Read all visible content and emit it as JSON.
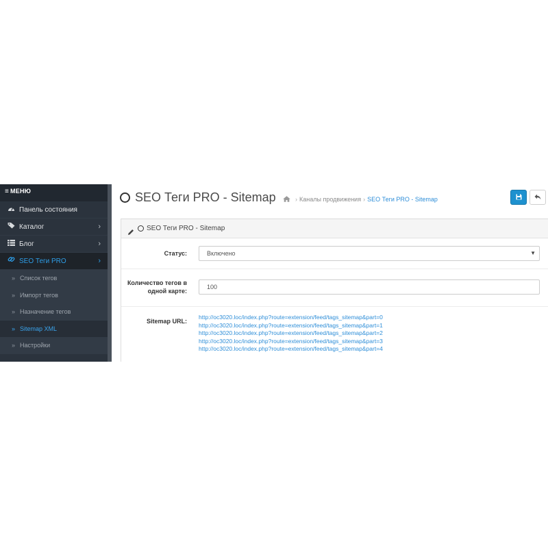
{
  "sidebar": {
    "menu_label": "МЕНЮ",
    "items": [
      {
        "label": "Панель состояния",
        "icon": "dashboard-icon",
        "has_chevron": false
      },
      {
        "label": "Каталог",
        "icon": "tags-icon",
        "has_chevron": true
      },
      {
        "label": "Блог",
        "icon": "list-icon",
        "has_chevron": true
      },
      {
        "label": "SEO Теги PRO",
        "icon": "link-icon",
        "has_chevron": true,
        "active": true
      }
    ],
    "subitems": [
      {
        "label": "Список тегов"
      },
      {
        "label": "Импорт тегов"
      },
      {
        "label": "Назначение тегов"
      },
      {
        "label": "Sitemap XML",
        "active": true
      },
      {
        "label": "Настройки"
      }
    ],
    "colors": {
      "background": "#2b333d",
      "active_text": "#2e9ee8"
    }
  },
  "header": {
    "title": "SEO Теги PRO - Sitemap",
    "breadcrumb": {
      "home_icon": "home-icon",
      "items": [
        "Каналы продвижения",
        "SEO Теги PRO - Sitemap"
      ]
    },
    "save_icon": "floppy-disk-icon",
    "back_icon": "reply-arrow-icon",
    "accent_color": "#1e91cf"
  },
  "panel": {
    "title": "SEO Теги PRO - Sitemap",
    "status": {
      "label": "Статус:",
      "value": "Включено"
    },
    "tags_per_map": {
      "label": "Количество тегов в одной карте:",
      "value": "100"
    },
    "sitemap": {
      "label": "Sitemap URL:",
      "links": [
        "http://oc3020.loc/index.php?route=extension/feed/tags_sitemap&part=0",
        "http://oc3020.loc/index.php?route=extension/feed/tags_sitemap&part=1",
        "http://oc3020.loc/index.php?route=extension/feed/tags_sitemap&part=2",
        "http://oc3020.loc/index.php?route=extension/feed/tags_sitemap&part=3",
        "http://oc3020.loc/index.php?route=extension/feed/tags_sitemap&part=4"
      ]
    }
  }
}
